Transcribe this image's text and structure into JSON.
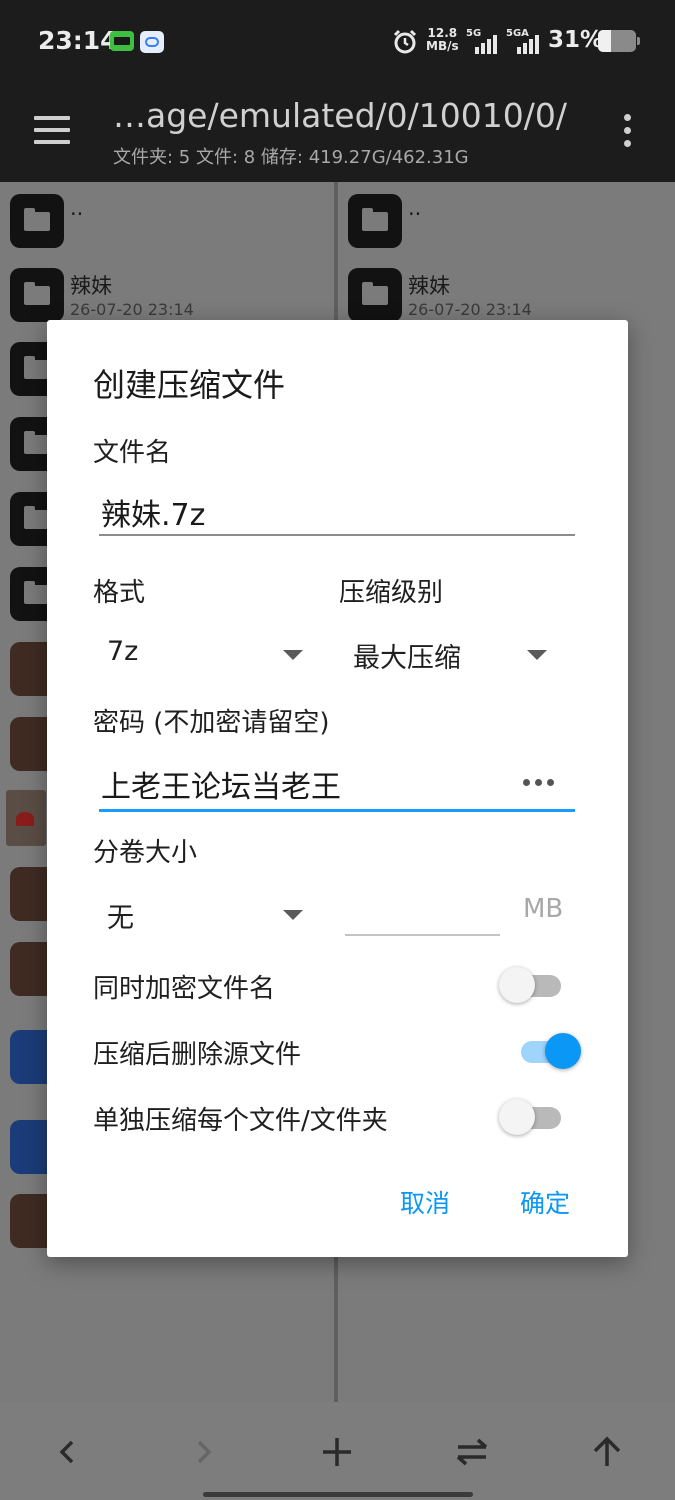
{
  "status_bar": {
    "time": "23:14",
    "net_speed_value": "12.8",
    "net_speed_unit": "MB/s",
    "signal1_label": "5G",
    "signal2_label": "5GA",
    "battery": "31%"
  },
  "toolbar": {
    "path": "…age/emulated/0/10010/0/",
    "info": "文件夹: 5   文件: 8   储存: 419.27G/462.31G"
  },
  "left_pane": {
    "rows": [
      {
        "name": "..",
        "date": ""
      },
      {
        "name": "辣妹",
        "date": "26-07-20 23:14"
      }
    ]
  },
  "right_pane": {
    "rows": [
      {
        "name": "..",
        "date": ""
      },
      {
        "name": "辣妹",
        "date": "26-07-20 23:14"
      }
    ]
  },
  "dialog": {
    "title": "创建压缩文件",
    "filename_label": "文件名",
    "filename_value": "辣妹.7z",
    "format_label": "格式",
    "format_value": "7z",
    "level_label": "压缩级别",
    "level_value": "最大压缩",
    "password_label": "密码 (不加密请留空)",
    "password_value": "上老王论坛当老王",
    "split_label": "分卷大小",
    "split_value": "无",
    "split_size_value": "",
    "split_unit": "MB",
    "options": [
      {
        "label": "同时加密文件名",
        "on": false
      },
      {
        "label": "压缩后删除源文件",
        "on": true
      },
      {
        "label": "单独压缩每个文件/文件夹",
        "on": false
      }
    ],
    "cancel": "取消",
    "ok": "确定"
  },
  "colors": {
    "accent": "#0A97F5",
    "scrim": "#7A7A7A",
    "toolbar": "#1C1C1C"
  }
}
